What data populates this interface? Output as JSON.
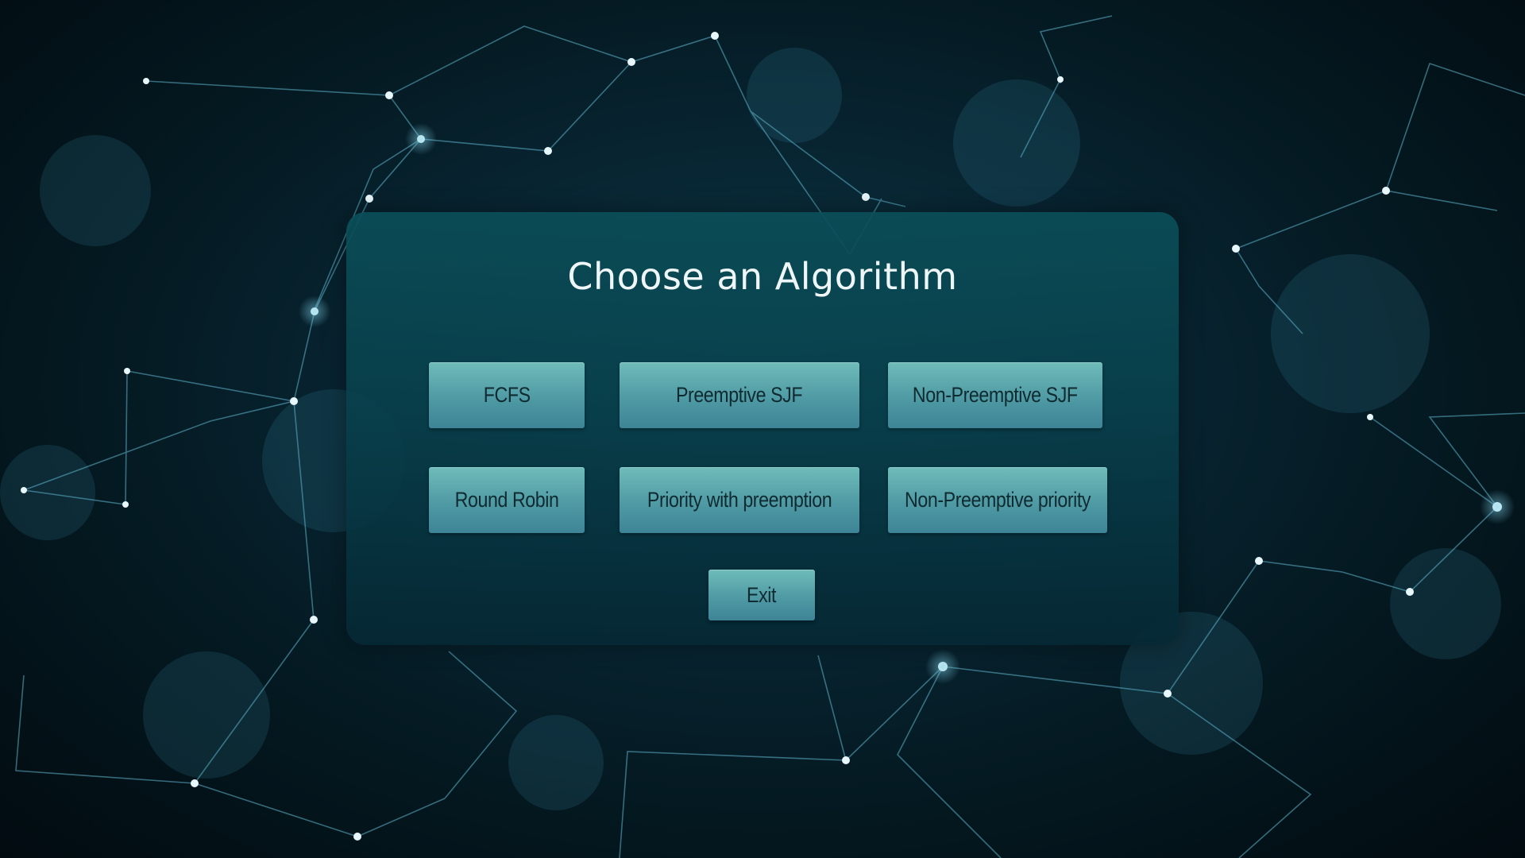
{
  "menu": {
    "title": "Choose an Algorithm",
    "buttons": {
      "fcfs": "FCFS",
      "preemptive_sjf": "Preemptive SJF",
      "non_preemptive_sjf": "Non-Preemptive SJF",
      "round_robin": "Round Robin",
      "priority_with_preemption": "Priority with preemption",
      "non_preemptive_priority": "Non-Preemptive priority",
      "exit": "Exit"
    }
  },
  "colors": {
    "background": "#041219",
    "panel": "#0a4e58",
    "button": "#5ba8ae",
    "button_text": "#0f2a30",
    "title_text": "#eef6f7",
    "network_line": "#5fb4cc"
  }
}
